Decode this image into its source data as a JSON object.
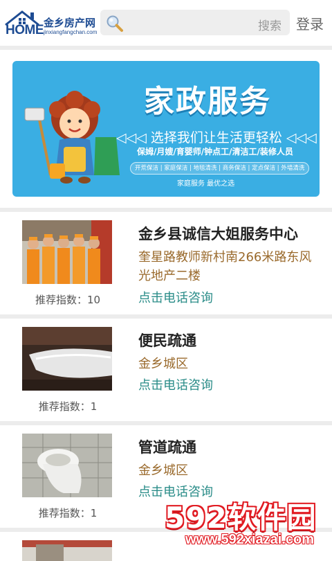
{
  "header": {
    "logo": {
      "home_text": "HOME",
      "cn_name": "金乡房产网",
      "domain": "jinxiangfangchan.com"
    },
    "search": {
      "placeholder": "搜索"
    },
    "login_label": "登录"
  },
  "banner": {
    "title": "家政服务",
    "slogan": "◁◁◁ 选择我们让生活更轻松 ◁◁◁",
    "services": "保姆/月嫂/育婴师/钟点工/清洁工/装修人员",
    "pills": "开荒保洁 | 家庭保洁 | 地毯清洗 | 商务保洁 | 定点保洁 | 外墙清洗",
    "motto": "家庭服务    最优之选"
  },
  "listings": [
    {
      "name": "金乡县诚信大姐服务中心",
      "address": "奎星路教师新村南266米路东风光地产二楼",
      "call": "点击电话咨询",
      "recommend": "推荐指数：10"
    },
    {
      "name": "便民疏通",
      "address": "金乡城区",
      "call": "点击电话咨询",
      "recommend": "推荐指数：1"
    },
    {
      "name": "管道疏通",
      "address": "金乡城区",
      "call": "点击电话咨询",
      "recommend": "推荐指数：1"
    }
  ],
  "watermark": {
    "brand": "592软件园",
    "url": "www.592xiazai.com"
  },
  "colors": {
    "banner": "#3aaee3",
    "logo": "#1e4c93",
    "address": "#9a6a2c",
    "call": "#2a8c88",
    "watermark": "#e11b22"
  }
}
